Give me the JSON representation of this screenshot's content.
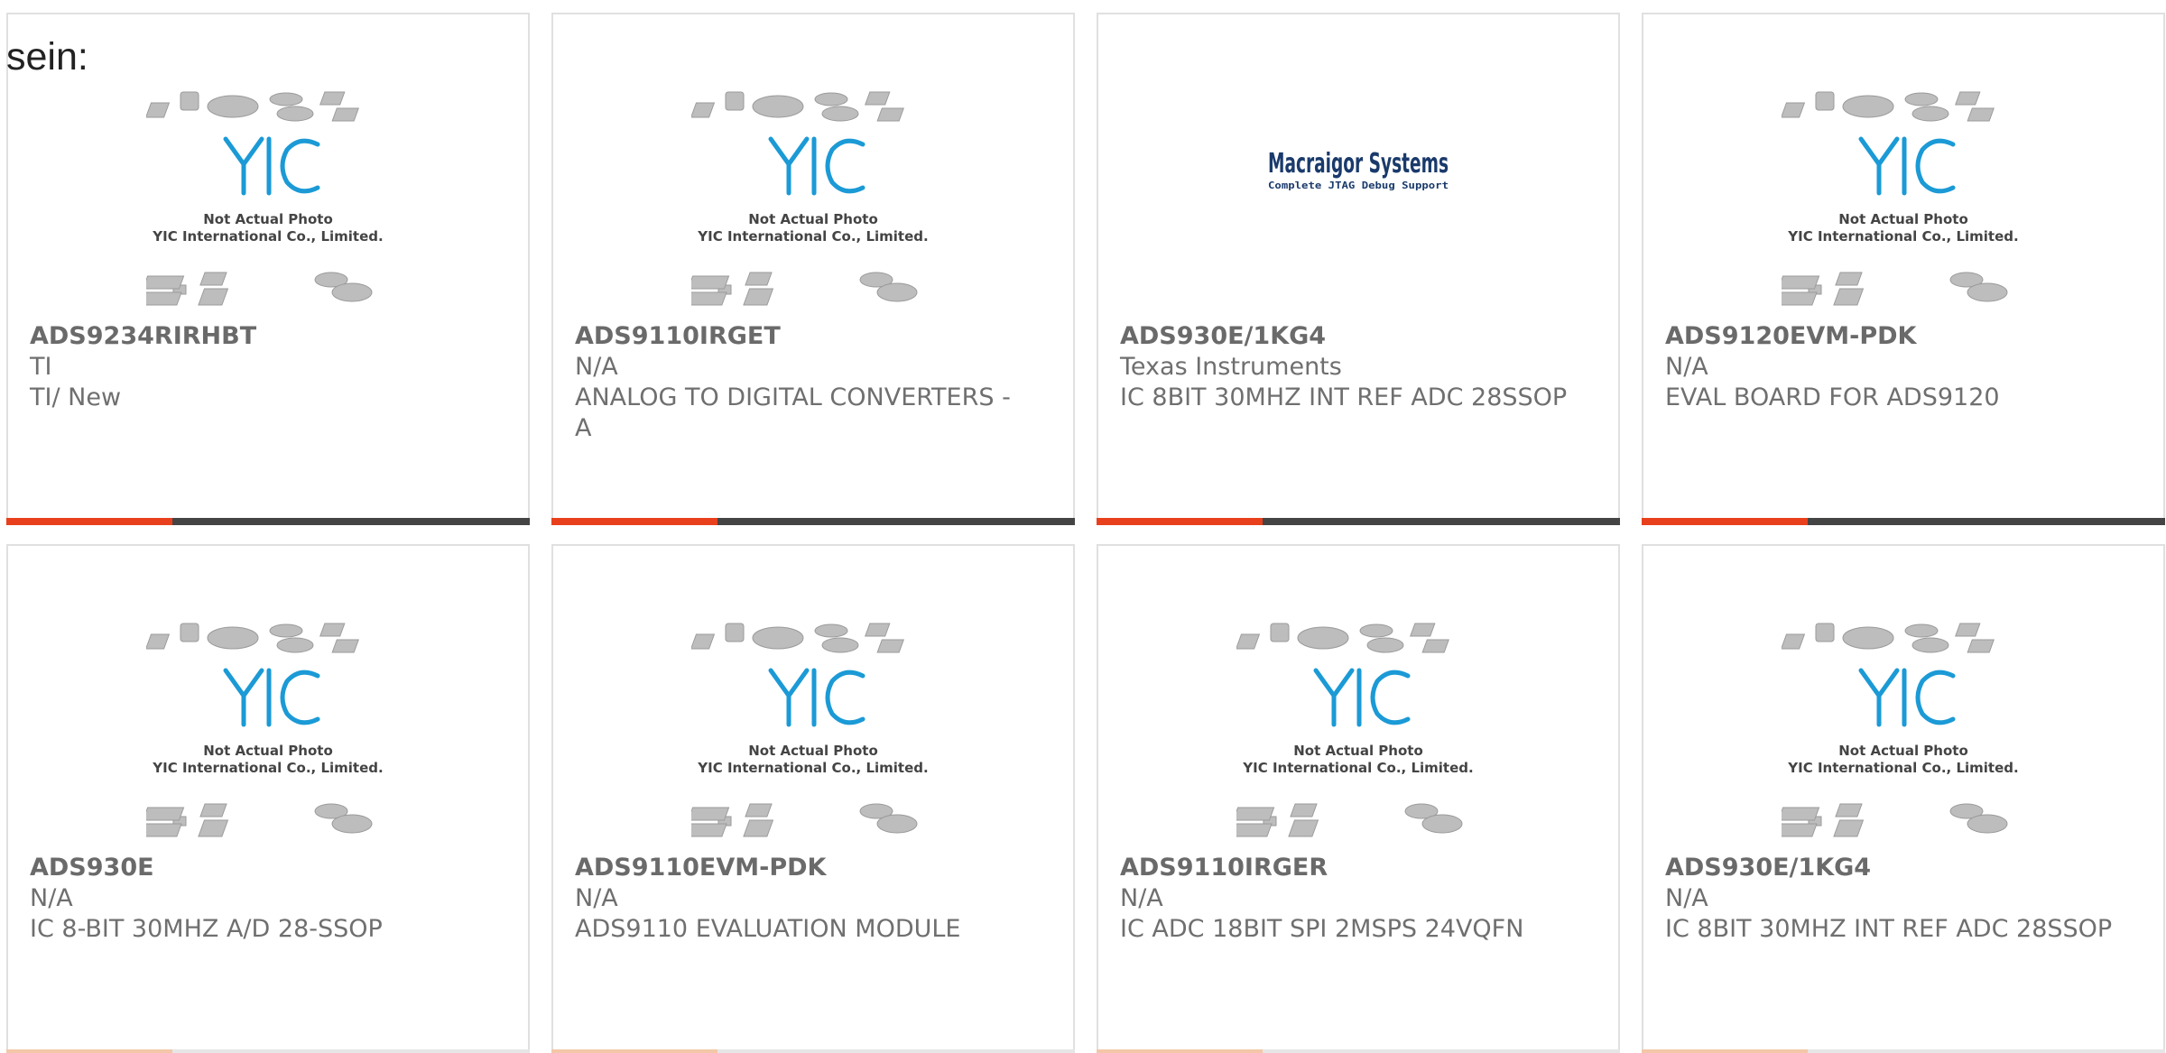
{
  "intro_text": "sein:",
  "placeholder_caption": {
    "line1": "Not Actual Photo",
    "line2": "YIC International Co., Limited."
  },
  "brand_logo": {
    "name": "Macraigor Systems",
    "tagline": "Complete JTAG Debug Support"
  },
  "colors": {
    "accent": "#e8401c",
    "bar_dark": "#444444",
    "logo_blue": "#1b9ad6",
    "brand_navy": "#1a3a6b"
  },
  "products": [
    {
      "part_number": "ADS9234RIRHBT",
      "manufacturer": "TI",
      "description": "TI/ New",
      "image": "yic-placeholder"
    },
    {
      "part_number": "ADS9110IRGET",
      "manufacturer": "N/A",
      "description": "ANALOG TO DIGITAL CONVERTERS - A",
      "image": "yic-placeholder"
    },
    {
      "part_number": "ADS930E/1KG4",
      "manufacturer": "Texas Instruments",
      "description": "IC 8BIT 30MHZ INT REF ADC 28SSOP",
      "image": "macraigor-logo"
    },
    {
      "part_number": "ADS9120EVM-PDK",
      "manufacturer": "N/A",
      "description": "EVAL BOARD FOR ADS9120",
      "image": "yic-placeholder"
    },
    {
      "part_number": "ADS930E",
      "manufacturer": "N/A",
      "description": "IC 8-BIT 30MHZ A/D 28-SSOP",
      "image": "yic-placeholder"
    },
    {
      "part_number": "ADS9110EVM-PDK",
      "manufacturer": "N/A",
      "description": "ADS9110 EVALUATION MODULE",
      "image": "yic-placeholder"
    },
    {
      "part_number": "ADS9110IRGER",
      "manufacturer": "N/A",
      "description": "IC ADC 18BIT SPI 2MSPS 24VQFN",
      "image": "yic-placeholder"
    },
    {
      "part_number": "ADS930E/1KG4",
      "manufacturer": "N/A",
      "description": "IC 8BIT 30MHZ INT REF ADC 28SSOP",
      "image": "yic-placeholder"
    }
  ]
}
